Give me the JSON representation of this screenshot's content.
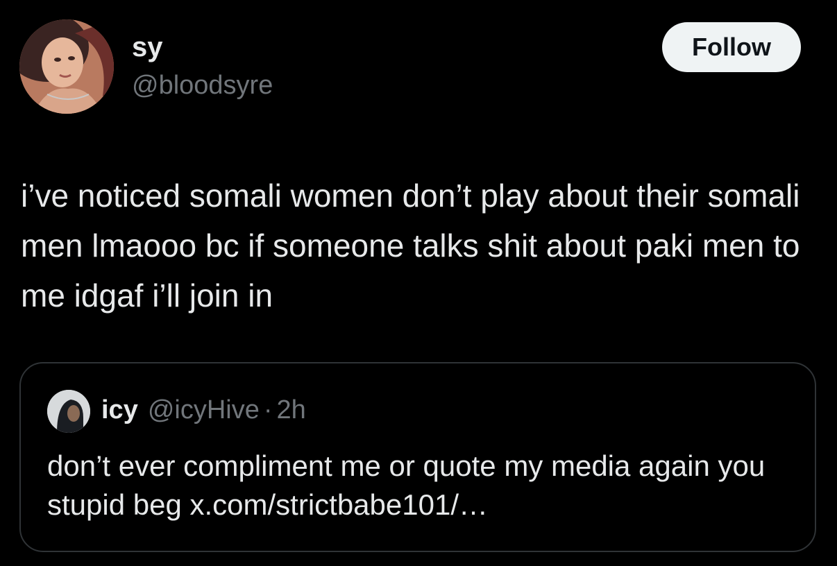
{
  "author": {
    "display_name": "sy",
    "handle": "@bloodsyre"
  },
  "follow_button": {
    "label": "Follow"
  },
  "tweet": {
    "text": "i’ve noticed somali women don’t play about their somali men lmaooo bc if someone talks shit about paki men to me idgaf i’ll join in"
  },
  "quoted_tweet": {
    "display_name": "icy",
    "handle": "@icyHive",
    "separator": "·",
    "time": "2h",
    "text": "don’t ever compliment me or quote my media again you stupid beg x.com/strictbabe101/…"
  },
  "colors": {
    "background": "#000000",
    "primary_text": "#e7e9ea",
    "secondary_text": "#71767b",
    "follow_button_bg": "#eff3f4",
    "follow_button_text": "#0f1419",
    "card_border": "#2f3336"
  }
}
